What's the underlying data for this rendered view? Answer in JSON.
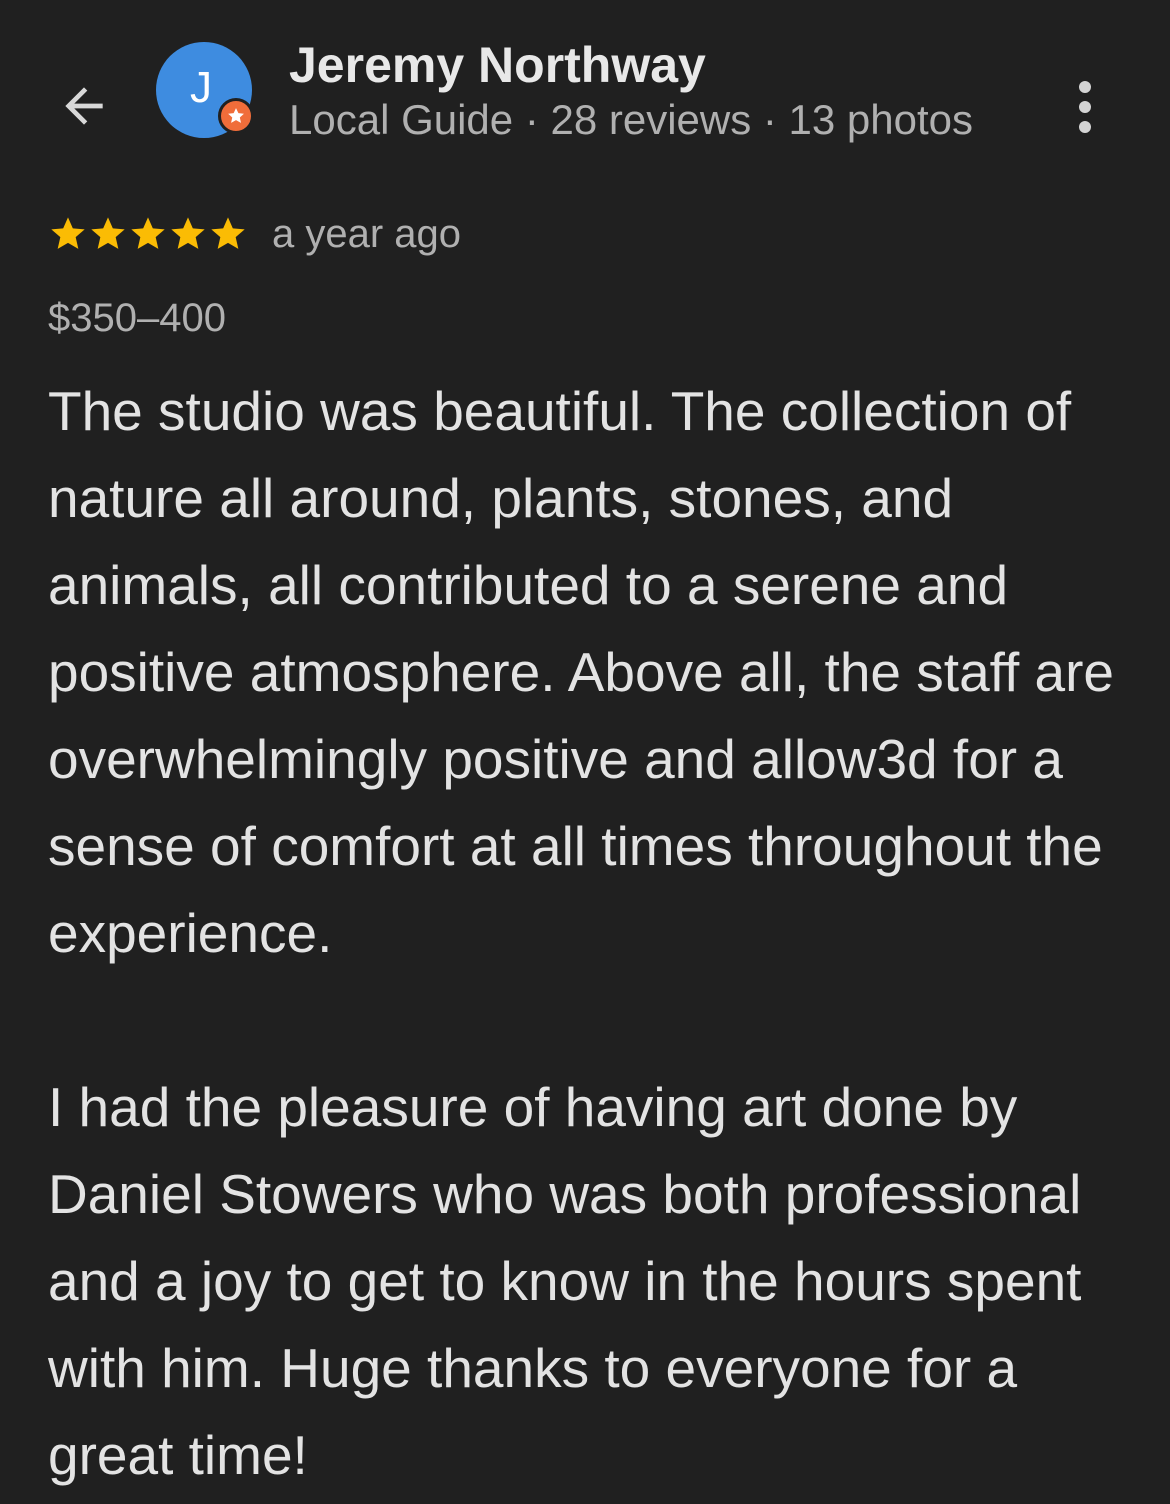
{
  "header": {
    "back_icon": "arrow-left-icon",
    "avatar_letter": "J",
    "avatar_color": "#3e8ce0",
    "badge_icon": "local-guide-star-icon",
    "badge_color": "#f06d3a",
    "user_name": "Jeremy Northway",
    "user_meta": "Local Guide · 28 reviews · 13 photos",
    "more_icon": "more-vert-icon"
  },
  "review": {
    "rating": 5,
    "rating_max": 5,
    "star_color": "#fbbc04",
    "date": "a year ago",
    "price_range": "$350–400",
    "paragraphs": [
      "The studio was beautiful. The collection of nature all around, plants, stones, and animals, all contributed to a serene and positive atmosphere. Above all, the staff are overwhelmingly positive and allow3d for a sense of comfort at all times throughout the experience.",
      "I had the pleasure of having art done by Daniel Stowers who was both professional and a joy to get to know in the hours spent with him. Huge thanks to everyone for a great time!"
    ]
  }
}
